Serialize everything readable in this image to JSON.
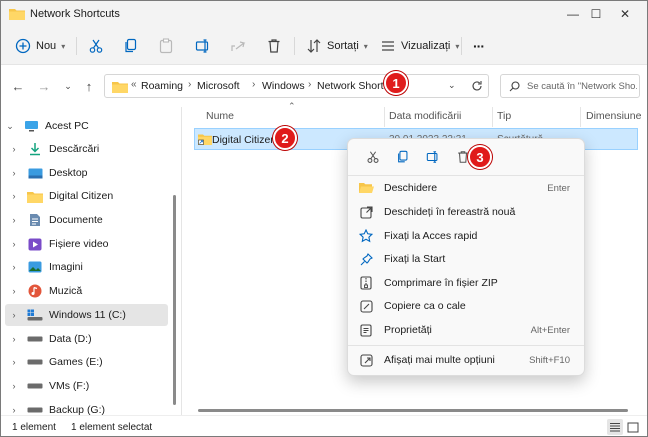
{
  "window": {
    "title": "Network Shortcuts",
    "minimize": "—",
    "maximize": "☐",
    "close": "✕"
  },
  "toolbar": {
    "new_label": "Nou",
    "sort_label": "Sortați",
    "view_label": "Vizualizați",
    "more_label": "···"
  },
  "address": {
    "overflow": "«",
    "crumbs": [
      "Roaming",
      "Microsoft",
      "Windows",
      "Network Shortcuts"
    ],
    "separator": "›",
    "search_placeholder": "Se caută în \"Network Sho..."
  },
  "sidebar": {
    "items": [
      {
        "label": "Acest PC",
        "chevron": "⌄",
        "icon": "pc-icon"
      },
      {
        "label": "Descărcări",
        "chevron": "›",
        "icon": "download-icon"
      },
      {
        "label": "Desktop",
        "chevron": "›",
        "icon": "desktop-icon"
      },
      {
        "label": "Digital Citizen",
        "chevron": "›",
        "icon": "folder-icon"
      },
      {
        "label": "Documente",
        "chevron": "›",
        "icon": "documents-icon"
      },
      {
        "label": "Fișiere video",
        "chevron": "›",
        "icon": "video-icon"
      },
      {
        "label": "Imagini",
        "chevron": "›",
        "icon": "pictures-icon"
      },
      {
        "label": "Muzică",
        "chevron": "›",
        "icon": "music-icon"
      },
      {
        "label": "Windows 11 (C:)",
        "chevron": "›",
        "icon": "drive-c-icon"
      },
      {
        "label": "Data (D:)",
        "chevron": "›",
        "icon": "drive-icon"
      },
      {
        "label": "Games (E:)",
        "chevron": "›",
        "icon": "drive-icon"
      },
      {
        "label": "VMs (F:)",
        "chevron": "›",
        "icon": "drive-icon"
      },
      {
        "label": "Backup (G:)",
        "chevron": "›",
        "icon": "drive-icon"
      }
    ]
  },
  "list": {
    "columns": [
      "Nume",
      "Data modificării",
      "Tip",
      "Dimensiune"
    ],
    "sort_indicator": "⌃",
    "rows": [
      {
        "name": "Digital Citizen",
        "date": "30.01.2023 22:31",
        "type": "Scurtătură"
      }
    ]
  },
  "context_menu": {
    "items": [
      {
        "label": "Deschidere",
        "shortcut": "Enter",
        "icon": "open-folder-icon"
      },
      {
        "label": "Deschideți în fereastră nouă",
        "shortcut": "",
        "icon": "new-window-icon"
      },
      {
        "label": "Fixați la Acces rapid",
        "shortcut": "",
        "icon": "star-icon"
      },
      {
        "label": "Fixați la Start",
        "shortcut": "",
        "icon": "pin-icon"
      },
      {
        "label": "Comprimare în fișier ZIP",
        "shortcut": "",
        "icon": "zip-icon"
      },
      {
        "label": "Copiere ca o cale",
        "shortcut": "",
        "icon": "copy-path-icon"
      },
      {
        "label": "Proprietăți",
        "shortcut": "Alt+Enter",
        "icon": "properties-icon"
      },
      {
        "label": "Afișați mai multe opțiuni",
        "shortcut": "Shift+F10",
        "icon": "more-options-icon"
      }
    ]
  },
  "badges": [
    "1",
    "2",
    "3"
  ],
  "status": {
    "count": "1 element",
    "selected": "1 element selectat"
  },
  "colors": {
    "accent": "#0067c0",
    "selection": "#cce8ff",
    "badge": "#e01b1b",
    "folder": "#f7c64a"
  }
}
